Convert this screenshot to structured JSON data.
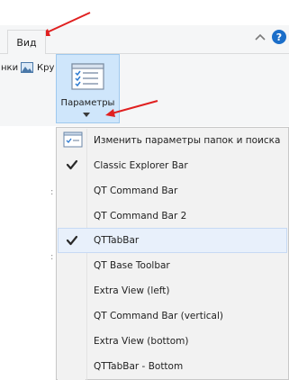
{
  "ribbon": {
    "tab_view": "Вид",
    "left_label": "нки",
    "right_label": "Кру",
    "params_button": "Параметры"
  },
  "menu": {
    "items": [
      {
        "label": "Изменить параметры папок и поиска",
        "icon": "folder-options-icon",
        "checked": false
      },
      {
        "label": "Classic Explorer Bar",
        "checked": true
      },
      {
        "label": "QT Command Bar",
        "checked": false
      },
      {
        "label": "QT Command Bar 2",
        "checked": false
      },
      {
        "label": "QTTabBar",
        "checked": true,
        "highlighted": true
      },
      {
        "label": "QT Base Toolbar",
        "checked": false
      },
      {
        "label": "Extra View (left)",
        "checked": false
      },
      {
        "label": "QT Command Bar (vertical)",
        "checked": false
      },
      {
        "label": "Extra View (bottom)",
        "checked": false
      },
      {
        "label": "QTTabBar - Bottom",
        "checked": false
      }
    ]
  },
  "colors": {
    "accent": "#1b6ec9",
    "arrow": "#e02020",
    "ribbon_bg": "#f5f6f7",
    "highlight_bg": "#e8f0fb"
  }
}
